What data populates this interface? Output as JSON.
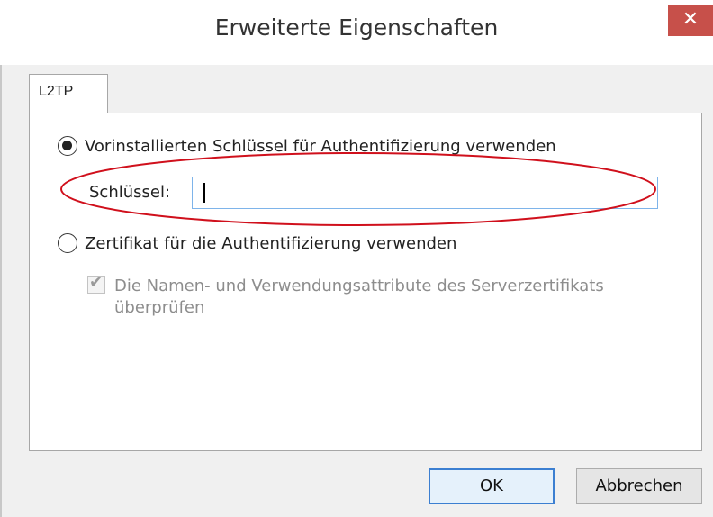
{
  "window": {
    "title": "Erweiterte Eigenschaften",
    "close_glyph": "✕"
  },
  "tabs": [
    {
      "label": "L2TP"
    }
  ],
  "options": {
    "preshared_key_label": "Vorinstallierten Schlüssel für Authentifizierung verwenden",
    "preshared_key_selected": true,
    "key_field_label": "Schlüssel:",
    "key_field_value": "",
    "certificate_label": "Zertifikat für die Authentifizierung verwenden",
    "certificate_selected": false,
    "verify_attributes_label": "Die Namen- und Verwendungsattribute des Serverzertifikats überprüfen",
    "verify_attributes_checked": true,
    "verify_attributes_enabled": false
  },
  "buttons": {
    "ok": "OK",
    "cancel": "Abbrechen"
  },
  "colors": {
    "annotation": "#d0101c",
    "close": "#c7504a",
    "focus_border": "#7eb4ea"
  }
}
